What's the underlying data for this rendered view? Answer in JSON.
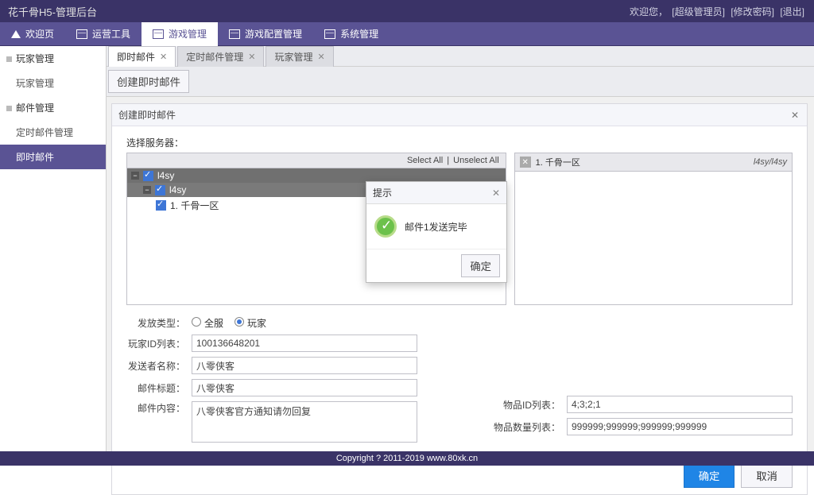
{
  "header": {
    "title": "花千骨H5-管理后台",
    "welcome_prefix": "欢迎您，",
    "user_role": "[超级管理员]",
    "change_pw": "[修改密码]",
    "logout": "[退出]"
  },
  "main_nav": [
    {
      "label": "欢迎页"
    },
    {
      "label": "运营工具"
    },
    {
      "label": "游戏管理"
    },
    {
      "label": "游戏配置管理"
    },
    {
      "label": "系统管理"
    }
  ],
  "main_nav_active": 2,
  "sidebar": {
    "groups": [
      {
        "label": "玩家管理",
        "items": [
          {
            "label": "玩家管理"
          }
        ]
      },
      {
        "label": "邮件管理",
        "items": [
          {
            "label": "定时邮件管理"
          },
          {
            "label": "即时邮件"
          }
        ]
      }
    ],
    "active": "即时邮件"
  },
  "sub_tabs": [
    {
      "label": "即时邮件"
    },
    {
      "label": "定时邮件管理"
    },
    {
      "label": "玩家管理"
    }
  ],
  "sub_tab_active": 0,
  "toolbar": {
    "create_label": "创建即时邮件"
  },
  "panel": {
    "title": "创建即时邮件",
    "select_server_label": "选择服务器：",
    "select_all": "Select All",
    "unselect_all": "Unselect All",
    "tree": {
      "node1": "l4sy",
      "node2": "l4sy",
      "leaf": "1. 千骨一区"
    },
    "right_selected": {
      "label": "1. 千骨一区",
      "path": "l4sy/l4sy"
    },
    "form": {
      "dist_label": "发放类型：",
      "dist_all": "全服",
      "dist_player": "玩家",
      "player_id_label": "玩家ID列表：",
      "player_id_value": "100136648201",
      "sender_label": "发送者名称：",
      "sender_value": "八零侠客",
      "title_label": "邮件标题：",
      "title_value": "八零侠客",
      "content_label": "邮件内容：",
      "content_value": "八零侠客官方通知请勿回复",
      "item_id_label": "物品ID列表：",
      "item_id_value": "4;3;2;1",
      "item_qty_label": "物品数量列表：",
      "item_qty_value": "999999;999999;999999;999999"
    },
    "confirm": "确定",
    "cancel": "取消"
  },
  "modal": {
    "title": "提示",
    "message": "邮件1发送完毕",
    "ok": "确定"
  },
  "footer": "Copyright ? 2011-2019 www.80xk.cn"
}
